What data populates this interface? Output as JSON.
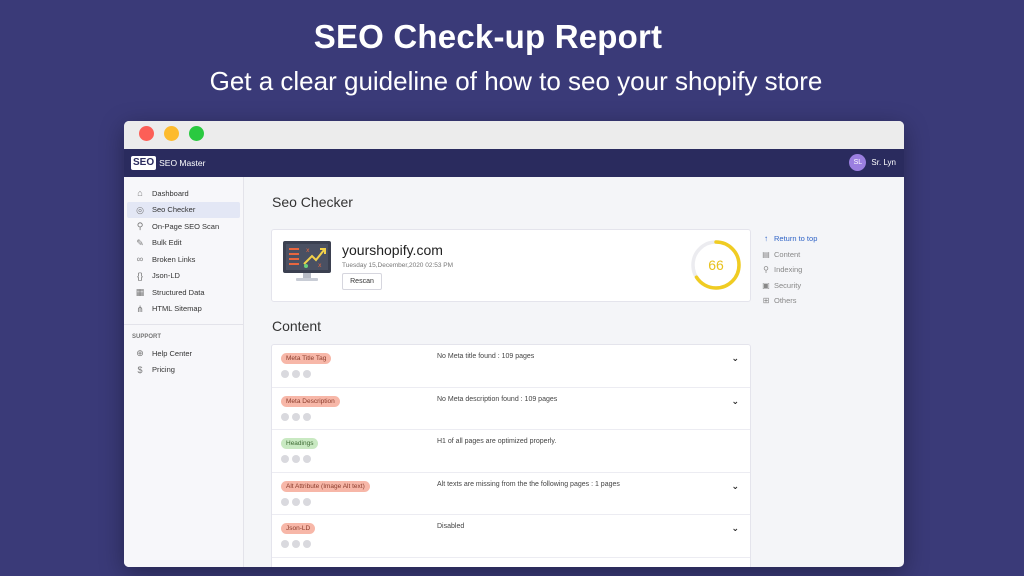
{
  "hero": {
    "title": "SEO Check-up Report",
    "subtitle": "Get a clear guideline of how to seo your shopify store"
  },
  "appbar": {
    "logo_mark": "SEO",
    "app_name": "SEO Master",
    "user_initials": "SL",
    "user_name": "Sr. Lyn"
  },
  "sidebar": {
    "items": [
      {
        "label": "Dashboard",
        "icon": "home-icon"
      },
      {
        "label": "Seo Checker",
        "icon": "target-icon",
        "active": true
      },
      {
        "label": "On-Page SEO Scan",
        "icon": "search-icon"
      },
      {
        "label": "Bulk Edit",
        "icon": "pencil-icon"
      },
      {
        "label": "Broken Links",
        "icon": "link-icon"
      },
      {
        "label": "Json-LD",
        "icon": "braces-icon"
      },
      {
        "label": "Structured Data",
        "icon": "calendar-icon"
      },
      {
        "label": "HTML Sitemap",
        "icon": "sitemap-icon"
      }
    ],
    "support_label": "SUPPORT",
    "support_items": [
      {
        "label": "Help Center",
        "icon": "help-icon"
      },
      {
        "label": "Pricing",
        "icon": "dollar-icon"
      }
    ]
  },
  "main": {
    "page_title": "Seo Checker",
    "site": "yourshopify.com",
    "date": "Tuesday 15,December,2020 02:53 PM",
    "rescan_label": "Rescan",
    "score": "66",
    "score_fraction": 0.66,
    "content_title": "Content"
  },
  "toc": [
    {
      "label": "Return to top",
      "icon": "arrow-up-icon"
    },
    {
      "label": "Content",
      "icon": "document-icon"
    },
    {
      "label": "Indexing",
      "icon": "search-icon"
    },
    {
      "label": "Security",
      "icon": "lock-icon"
    },
    {
      "label": "Others",
      "icon": "grid-icon"
    }
  ],
  "checks": [
    {
      "tag": "Meta Title Tag",
      "status": "bad",
      "message": "No Meta title found : 109 pages",
      "expandable": true
    },
    {
      "tag": "Meta Description",
      "status": "bad",
      "message": "No Meta description found : 109 pages",
      "expandable": true
    },
    {
      "tag": "Headings",
      "status": "good",
      "message": "H1 of all pages are optimized properly.",
      "expandable": false
    },
    {
      "tag": "Alt Attribute (Image Alt text)",
      "status": "bad",
      "message": "Alt texts are missing from the the following pages : 1 pages",
      "expandable": true
    },
    {
      "tag": "Json-LD",
      "status": "bad",
      "message": "Disabled",
      "expandable": true
    }
  ],
  "colors": {
    "background": "#3a3a78",
    "appbar": "#2a2b5e",
    "accent": "#2f63c6",
    "score": "#e8c21e",
    "tag_bad": "#f7b7a8",
    "tag_good": "#c9e9c2"
  }
}
